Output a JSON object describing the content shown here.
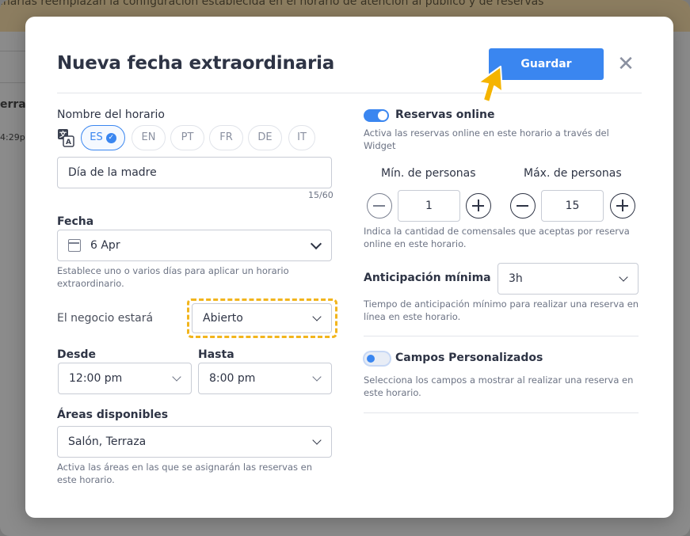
{
  "background": {
    "banner_text": "inarias reemplazan la configuración establecida en el horario de atención al público y de reservas",
    "fragment_1": "erra",
    "fragment_2": "4:29p"
  },
  "modal": {
    "title": "Nueva fecha extraordinaria",
    "save_label": "Guardar",
    "close_glyph": "✕"
  },
  "left": {
    "schedule_name_label": "Nombre del horario",
    "languages": [
      {
        "code": "ES",
        "active": true
      },
      {
        "code": "EN",
        "active": false
      },
      {
        "code": "PT",
        "active": false
      },
      {
        "code": "FR",
        "active": false
      },
      {
        "code": "DE",
        "active": false
      },
      {
        "code": "IT",
        "active": false
      }
    ],
    "schedule_name_value": "Día de la madre",
    "char_counter": "15/60",
    "date_label": "Fecha",
    "date_value": "6 Apr",
    "date_help": "Establece uno o varios días para aplicar un horario extraordinario.",
    "business_label": "El negocio estará",
    "business_value": "Abierto",
    "from_label": "Desde",
    "from_value": "12:00 pm",
    "to_label": "Hasta",
    "to_value": "8:00 pm",
    "areas_label": "Áreas disponibles",
    "areas_value": "Salón, Terraza",
    "areas_help": "Activa las áreas en las que se asignarán las reservas en este horario."
  },
  "right": {
    "online_label": "Reservas online",
    "online_enabled": true,
    "online_help": "Activa las reservas online en este horario a través del Widget",
    "min_people_label": "Mín. de personas",
    "min_people_value": "1",
    "max_people_label": "Máx. de personas",
    "max_people_value": "15",
    "people_help": "Indica la cantidad de comensales que aceptas por reserva online en este horario.",
    "advance_label": "Anticipación mínima",
    "advance_value": "3h",
    "advance_help": "Tiempo de anticipación mínimo para realizar una reserva en línea en este horario.",
    "custom_fields_label": "Campos Personalizados",
    "custom_fields_enabled": false,
    "custom_fields_help": "Selecciona los campos a mostrar al realizar una reserva en este horario."
  },
  "colors": {
    "accent": "#3a86f0",
    "focus_highlight": "#f2b51d",
    "cursor": "#f5b400"
  }
}
